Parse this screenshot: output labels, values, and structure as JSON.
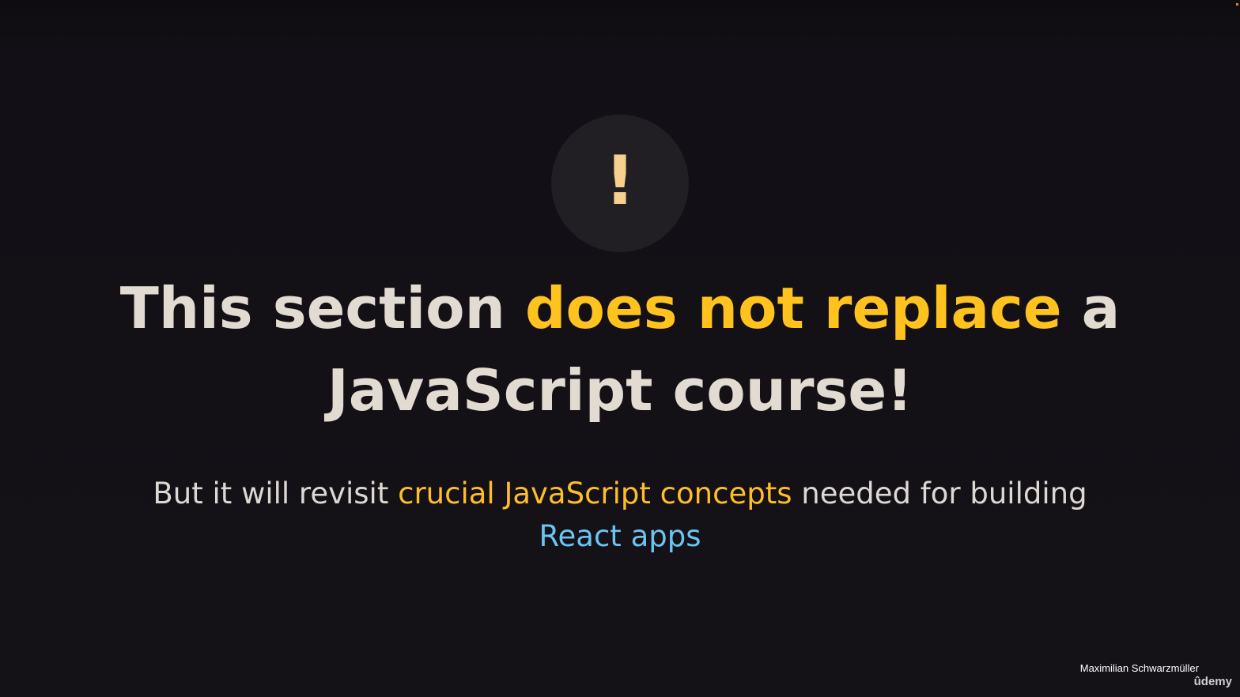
{
  "slide": {
    "warning_icon": "exclamation-icon",
    "warning_glyph": "!",
    "headline": {
      "part1": "This section ",
      "highlight": "does not replace",
      "part2": " a JavaScript course!"
    },
    "subline": {
      "part1": "But it will revisit ",
      "highlight_amber": "crucial JavaScript concepts",
      "part2": " needed for building ",
      "highlight_blue": "React apps"
    }
  },
  "watermark": {
    "author": "Maximilian Schwarzmüller",
    "brand": "ûdemy"
  },
  "colors": {
    "background": "#141117",
    "headline_text": "#e2dbd1",
    "headline_highlight": "#ffc21f",
    "subline_highlight_amber": "#ffbd26",
    "subline_highlight_blue": "#6cc4f3",
    "icon_circle": "#221f24",
    "icon_glyph": "#f6d08c"
  }
}
